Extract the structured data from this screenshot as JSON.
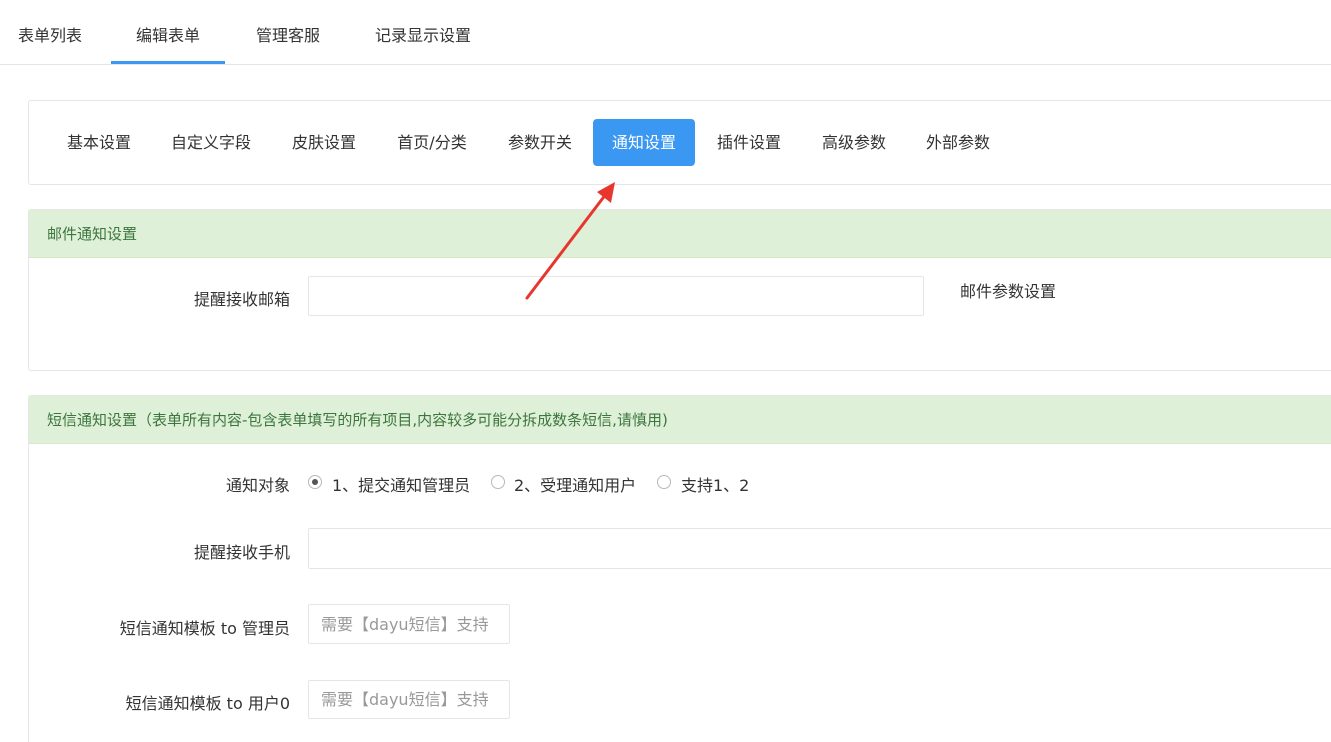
{
  "top_tabs": [
    {
      "label": "表单列表"
    },
    {
      "label": "编辑表单"
    },
    {
      "label": "管理客服"
    },
    {
      "label": "记录显示设置"
    }
  ],
  "sub_tabs": [
    {
      "label": "基本设置"
    },
    {
      "label": "自定义字段"
    },
    {
      "label": "皮肤设置"
    },
    {
      "label": "首页/分类"
    },
    {
      "label": "参数开关"
    },
    {
      "label": "通知设置"
    },
    {
      "label": "插件设置"
    },
    {
      "label": "高级参数"
    },
    {
      "label": "外部参数"
    }
  ],
  "email_panel": {
    "title": "邮件通知设置",
    "field_label": "提醒接收邮箱",
    "field_value": "",
    "settings_link": "邮件参数设置"
  },
  "sms_panel": {
    "title": "短信通知设置（表单所有内容-包含表单填写的所有项目,内容较多可能分拆成数条短信,请慎用)",
    "target_label": "通知对象",
    "target_options": [
      "1、提交通知管理员",
      "2、受理通知用户",
      "支持1、2"
    ],
    "target_selected": "1、提交通知管理员",
    "phone_label": "提醒接收手机",
    "phone_value": "",
    "admin_template_label": "短信通知模板 to 管理员",
    "admin_template_placeholder": "需要【dayu短信】支持",
    "user_template_label": "短信通知模板 to 用户0",
    "user_template_placeholder": "需要【dayu短信】支持"
  },
  "colors": {
    "accent": "#3a97f2",
    "panel_header_bg": "#dff0d8",
    "panel_header_text": "#3c763d",
    "arrow": "#e8362f"
  }
}
